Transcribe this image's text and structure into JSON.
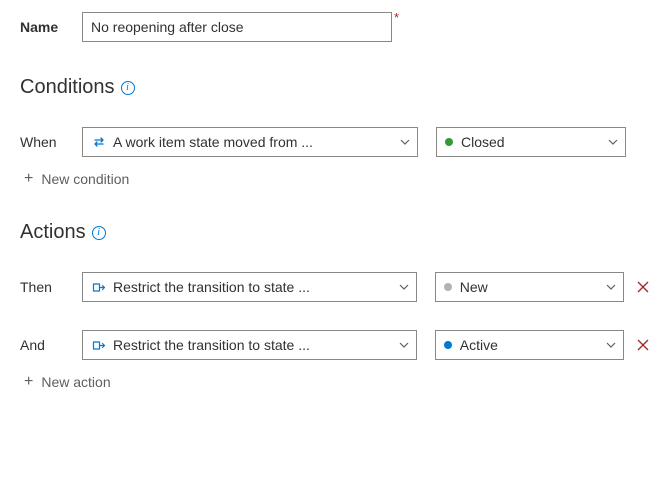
{
  "name": {
    "label": "Name",
    "value": "No reopening after close"
  },
  "conditions": {
    "heading": "Conditions",
    "rows": [
      {
        "label": "When",
        "typeText": "A work item state moved from ...",
        "stateText": "Closed",
        "stateColor": "green",
        "deletable": false
      }
    ],
    "addLabel": "New condition"
  },
  "actions": {
    "heading": "Actions",
    "rows": [
      {
        "label": "Then",
        "typeText": "Restrict the transition to state ...",
        "stateText": "New",
        "stateColor": "grey",
        "deletable": true
      },
      {
        "label": "And",
        "typeText": "Restrict the transition to state ...",
        "stateText": "Active",
        "stateColor": "blue",
        "deletable": true
      }
    ],
    "addLabel": "New action"
  }
}
